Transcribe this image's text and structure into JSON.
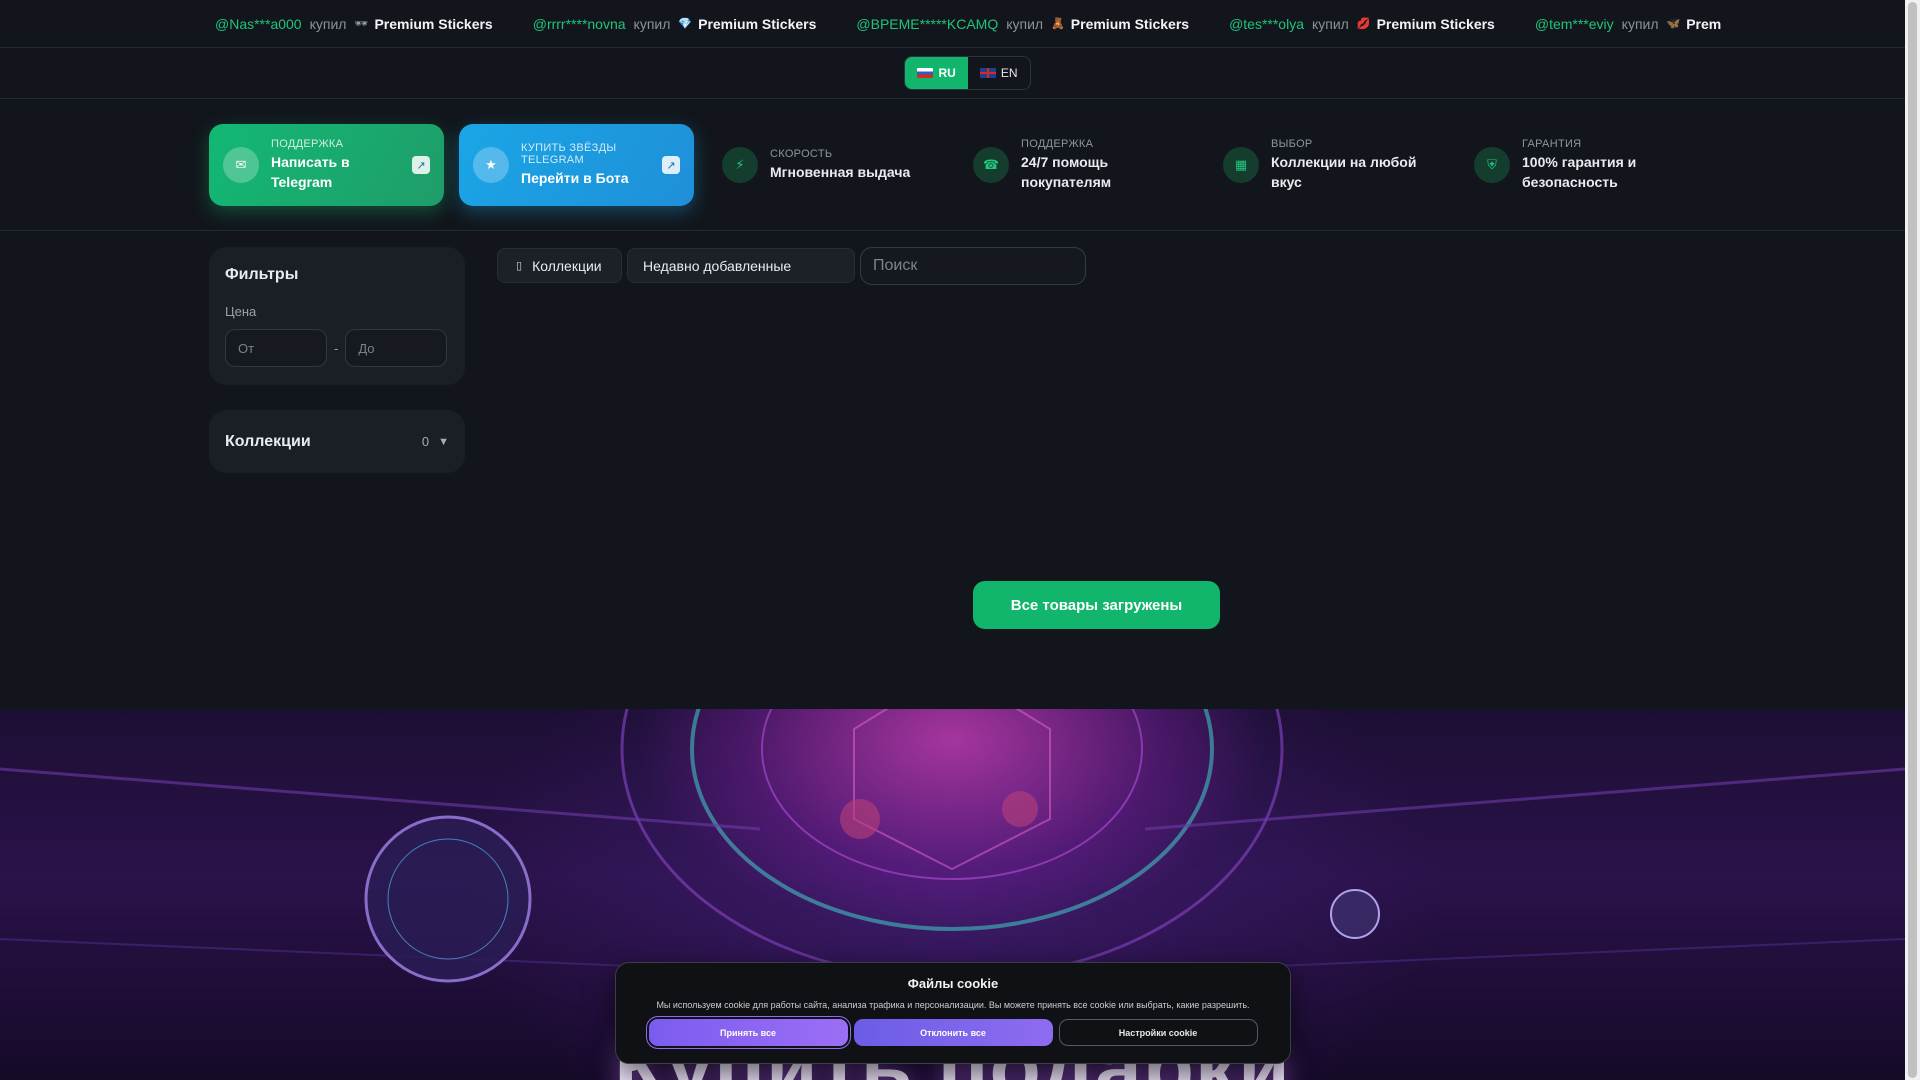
{
  "ticker": [
    {
      "user": "@Nas***a000",
      "verb": "купил",
      "icon": "🕶",
      "product": "Premium Stickers",
      "icon_color": "#9aa1a8"
    },
    {
      "user": "@rrrr****novna",
      "verb": "купил",
      "icon": "💎",
      "product": "Premium Stickers",
      "icon_color": "#5fb3ff"
    },
    {
      "user": "@ВРЕМЕ*****KCAMQ",
      "verb": "купил",
      "icon": "🧸",
      "product": "Premium Stickers",
      "icon_color": "#d6885a"
    },
    {
      "user": "@tes***olya",
      "verb": "купил",
      "icon": "💋",
      "product": "Premium Stickers",
      "icon_color": "#e0465a"
    },
    {
      "user": "@tem***eviy",
      "verb": "купил",
      "icon": "🦋",
      "product": "Prem",
      "icon_color": "#5f8bff"
    }
  ],
  "lang": {
    "ru": "RU",
    "en": "EN",
    "active": "RU"
  },
  "features": {
    "support": {
      "small": "ПОДДЕРЖКА",
      "big": "Написать в Telegram",
      "icon": "chat-icon",
      "arrow": "↗"
    },
    "bot": {
      "small": "КУПИТЬ ЗВЁЗДЫ TELEGRAM",
      "big": "Перейти в Бота",
      "icon": "star-icon",
      "arrow": "↗"
    },
    "speed": {
      "small": "СКОРОСТЬ",
      "big": "Мгновенная выдача",
      "icon": "bolt-icon"
    },
    "help": {
      "small": "ПОДДЕРЖКА",
      "big": "24/7 помощь покупателям",
      "icon": "headset-icon"
    },
    "choice": {
      "small": "ВЫБОР",
      "big": "Коллекции на любой вкус",
      "icon": "grid-icon"
    },
    "guarantee": {
      "small": "ГАРАНТИЯ",
      "big": "100% гарантия и безопасность",
      "icon": "shield-icon"
    }
  },
  "filters": {
    "title": "Фильтры",
    "price_label": "Цена",
    "from_placeholder": "От",
    "to_placeholder": "До",
    "dash": "-"
  },
  "collections_panel": {
    "title": "Коллекции",
    "count": "0",
    "arrow": "▼"
  },
  "toolbar": {
    "collections_label": "Коллекции",
    "sort_label": "Недавно добавленные",
    "search_placeholder": "Поиск"
  },
  "loaded_button": "Все товары загружены",
  "hero": {
    "title": "Купить подарки"
  },
  "cookie": {
    "title": "Файлы cookie",
    "text": "Мы используем cookie для работы сайта, анализа трафика и персонализации. Вы можете принять все cookie или выбрать, какие разрешить.",
    "accept": "Принять все",
    "reject": "Отклонить все",
    "settings": "Настройки cookie"
  },
  "colors": {
    "accent_green": "#11b56b",
    "accent_blue": "#1aa6e6",
    "accent_purple": "#8f6cf2"
  }
}
